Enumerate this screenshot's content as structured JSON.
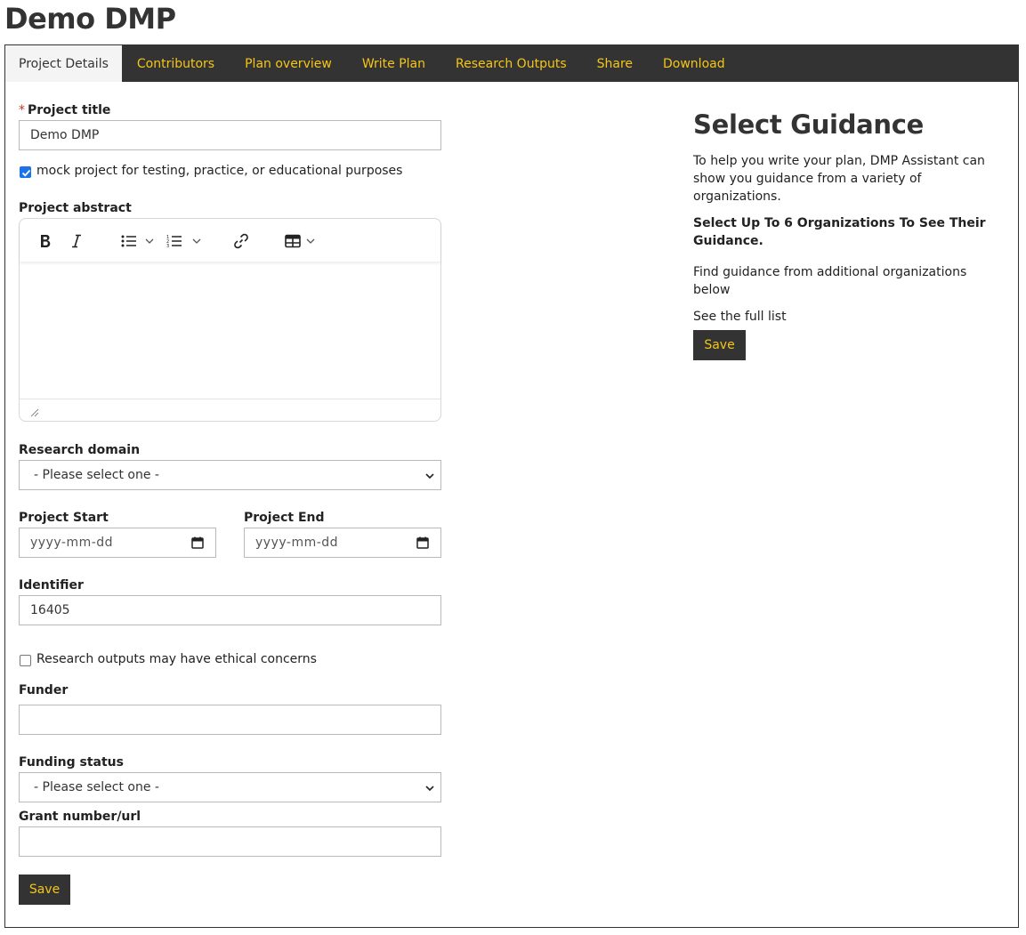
{
  "page": {
    "title": "Demo DMP"
  },
  "tabs": [
    {
      "label": "Project Details",
      "active": true
    },
    {
      "label": "Contributors",
      "active": false
    },
    {
      "label": "Plan overview",
      "active": false
    },
    {
      "label": "Write Plan",
      "active": false
    },
    {
      "label": "Research Outputs",
      "active": false
    },
    {
      "label": "Share",
      "active": false
    },
    {
      "label": "Download",
      "active": false
    }
  ],
  "form": {
    "project_title": {
      "label": "Project title",
      "required_marker": "*",
      "value": "Demo DMP"
    },
    "mock_project": {
      "label": "mock project for testing, practice, or educational purposes",
      "checked": true
    },
    "abstract": {
      "label": "Project abstract",
      "value": ""
    },
    "research_domain": {
      "label": "Research domain",
      "value": "- Please select one -"
    },
    "project_start": {
      "label": "Project Start",
      "value": "yyyy-mm-dd"
    },
    "project_end": {
      "label": "Project End",
      "value": "yyyy-mm-dd"
    },
    "identifier": {
      "label": "Identifier",
      "value": "16405"
    },
    "ethical": {
      "label": "Research outputs may have ethical concerns",
      "checked": false
    },
    "funder": {
      "label": "Funder",
      "value": ""
    },
    "funding_status": {
      "label": "Funding status",
      "value": "- Please select one -"
    },
    "grant": {
      "label": "Grant number/url",
      "value": ""
    },
    "save_label": "Save"
  },
  "guidance": {
    "title": "Select Guidance",
    "intro": "To help you write your plan, DMP Assistant can show you guidance from a variety of organizations.",
    "select_heading": "Select Up To 6 Organizations To See Their Guidance.",
    "find_more": "Find guidance from additional organizations below",
    "full_list": "See the full list",
    "save_label": "Save"
  },
  "colors": {
    "dark": "#333333",
    "accent": "#f5c518",
    "checkbox": "#1a73e8",
    "required": "#c0392b"
  },
  "icons": [
    "bold-icon",
    "italic-icon",
    "bulleted-list-icon",
    "numbered-list-icon",
    "link-icon",
    "table-icon",
    "chevron-down-icon",
    "calendar-icon",
    "resize-handle-icon"
  ]
}
